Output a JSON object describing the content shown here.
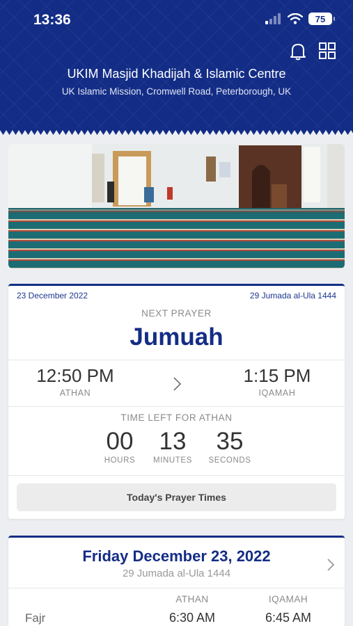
{
  "status_bar": {
    "time": "13:36",
    "battery": "75"
  },
  "header": {
    "title": "UKIM Masjid Khadijah & Islamic Centre",
    "subtitle": "UK Islamic Mission, Cromwell Road, Peterborough, UK",
    "icons": [
      "bell-icon",
      "grid-icon"
    ]
  },
  "next_prayer_card": {
    "gregorian_date": "23 December 2022",
    "hijri_date": "29 Jumada al-Ula 1444",
    "next_label": "NEXT PRAYER",
    "prayer_name": "Jumuah",
    "athan_time": "12:50 PM",
    "athan_label": "ATHAN",
    "iqamah_time": "1:15 PM",
    "iqamah_label": "IQAMAH",
    "time_left_label": "TIME LEFT FOR ATHAN",
    "hours": "00",
    "hours_label": "HOURS",
    "minutes": "13",
    "minutes_label": "MINUTES",
    "seconds": "35",
    "seconds_label": "SECONDS",
    "button_label": "Today's Prayer Times"
  },
  "day_card": {
    "title": "Friday December 23, 2022",
    "hijri": "29 Jumada al-Ula 1444",
    "col_athan": "ATHAN",
    "col_iqamah": "IQAMAH",
    "rows": [
      {
        "name": "Fajr",
        "athan": "6:30 AM",
        "iqamah": "6:45 AM"
      }
    ]
  },
  "colors": {
    "primary": "#142d85",
    "background": "#eceef2"
  }
}
